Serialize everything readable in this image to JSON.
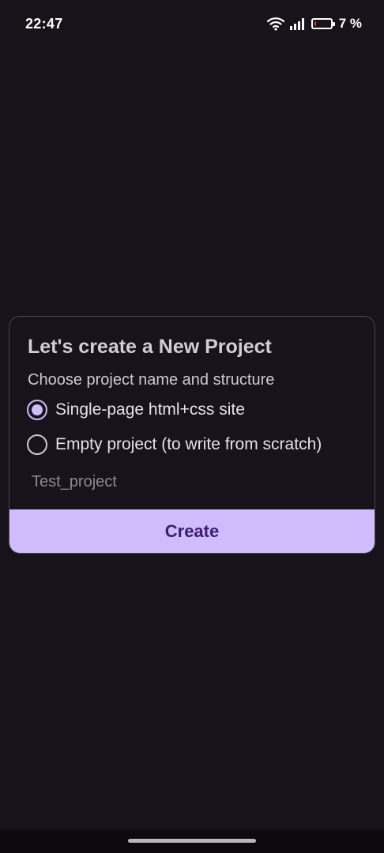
{
  "status_bar": {
    "time": "22:47",
    "battery_level": 0.07,
    "battery_text": "7 %",
    "icons": [
      "wifi-icon",
      "signal-icon",
      "battery-icon"
    ]
  },
  "dialog": {
    "title": "Let's create a New Project",
    "subtitle": "Choose project name and structure",
    "options": [
      {
        "label": "Single-page html+css site",
        "selected": true
      },
      {
        "label": "Empty project (to write from scratch)",
        "selected": false
      }
    ],
    "project_name": {
      "value": "",
      "placeholder": "Test_project"
    },
    "create_label": "Create"
  },
  "colors": {
    "background": "#16131a",
    "accent": "#d0bcfa",
    "button_text": "#3a1e72",
    "battery_low": "#e53935"
  }
}
